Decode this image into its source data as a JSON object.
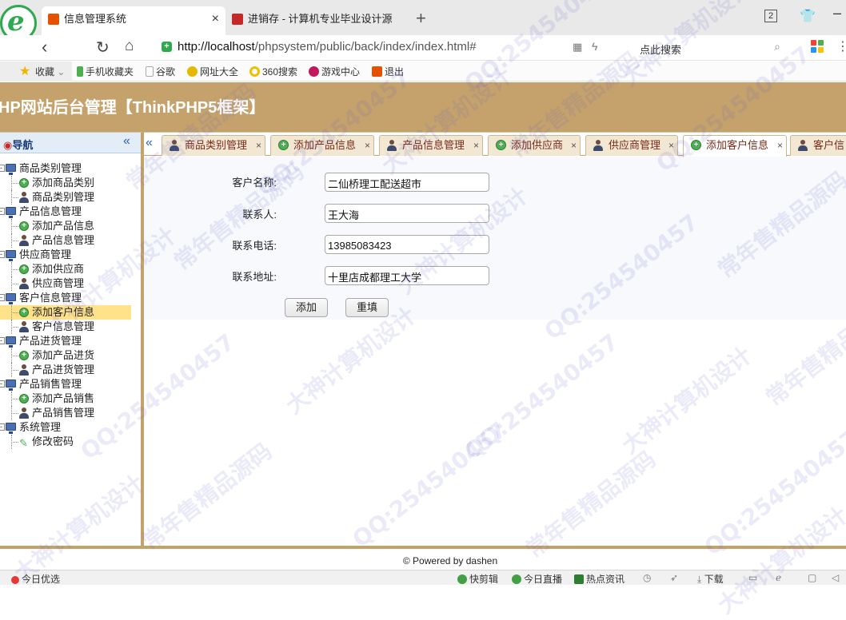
{
  "browser": {
    "tabs": [
      {
        "title": "信息管理系统",
        "active": true
      },
      {
        "title": "进销存 - 计算机专业毕业设计源",
        "active": false
      }
    ],
    "window_count": "2",
    "url_host": "http://localhost",
    "url_path": "/phpsystem/public/back/index/index.html#",
    "search_placeholder": "点此搜索",
    "bookmarks": [
      {
        "label": "收藏",
        "icon": "star-icon",
        "color": "#f1b400"
      },
      {
        "label": "手机收藏夹",
        "icon": "phone-icon",
        "color": "#4caf50"
      },
      {
        "label": "谷歌",
        "icon": "page-icon",
        "color": "#bdbdbd"
      },
      {
        "label": "网址大全",
        "icon": "plus-circle-icon",
        "color": "#e6b800"
      },
      {
        "label": "360搜索",
        "icon": "ring-icon",
        "color": "#f0c000"
      },
      {
        "label": "游戏中心",
        "icon": "game-icon",
        "color": "#c2185b"
      },
      {
        "label": "退出",
        "icon": "exit-icon",
        "color": "#e65100"
      }
    ]
  },
  "app": {
    "title": "HP网站后台管理【ThinkPHP5框架】",
    "nav_title": "导航",
    "tree": [
      {
        "label": "商品类别管理",
        "children": [
          {
            "label": "添加商品类别",
            "icon": "add"
          },
          {
            "label": "商品类别管理",
            "icon": "user"
          }
        ]
      },
      {
        "label": "产品信息管理",
        "children": [
          {
            "label": "添加产品信息",
            "icon": "add"
          },
          {
            "label": "产品信息管理",
            "icon": "user"
          }
        ]
      },
      {
        "label": "供应商管理",
        "children": [
          {
            "label": "添加供应商",
            "icon": "add"
          },
          {
            "label": "供应商管理",
            "icon": "user"
          }
        ]
      },
      {
        "label": "客户信息管理",
        "children": [
          {
            "label": "添加客户信息",
            "icon": "add",
            "selected": true
          },
          {
            "label": "客户信息管理",
            "icon": "user"
          }
        ]
      },
      {
        "label": "产品进货管理",
        "children": [
          {
            "label": "添加产品进货",
            "icon": "add"
          },
          {
            "label": "产品进货管理",
            "icon": "user"
          }
        ]
      },
      {
        "label": "产品销售管理",
        "children": [
          {
            "label": "添加产品销售",
            "icon": "add"
          },
          {
            "label": "产品销售管理",
            "icon": "user"
          }
        ]
      },
      {
        "label": "系统管理",
        "children": [
          {
            "label": "修改密码",
            "icon": "pen"
          }
        ]
      }
    ],
    "tabs": [
      {
        "label": "商品类别管理",
        "icon": "user"
      },
      {
        "label": "添加产品信息",
        "icon": "add"
      },
      {
        "label": "产品信息管理",
        "icon": "user"
      },
      {
        "label": "添加供应商",
        "icon": "add"
      },
      {
        "label": "供应商管理",
        "icon": "user"
      },
      {
        "label": "添加客户信息",
        "icon": "add",
        "active": true
      },
      {
        "label": "客户信",
        "icon": "user"
      }
    ],
    "form": {
      "fields": [
        {
          "label": "客户名称:",
          "value": "二仙桥理工配送超市"
        },
        {
          "label": "联系人:",
          "value": "王大海"
        },
        {
          "label": "联系电话:",
          "value": "13985083423"
        },
        {
          "label": "联系地址:",
          "value": "十里店成都理工大学"
        }
      ],
      "submit_label": "添加",
      "reset_label": "重填"
    },
    "footer": "© Powered by dashen"
  },
  "statusbar": {
    "left": "今日优选",
    "items": [
      "快剪辑",
      "今日直播",
      "热点资讯",
      "下载"
    ]
  },
  "watermarks": [
    "QQ:254540457",
    "大神计算机设计",
    "常年售精品源码"
  ],
  "colors": {
    "accent": "#c5a26c",
    "tab_text": "#7a2a1a",
    "selected": "#ffe28a"
  }
}
